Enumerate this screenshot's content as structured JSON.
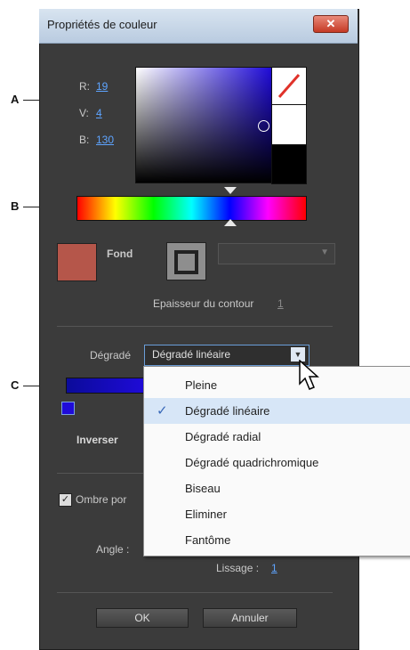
{
  "window": {
    "title": "Propriétés de couleur",
    "close_label": "✕"
  },
  "callouts": [
    "A",
    "B",
    "C"
  ],
  "color_picker": {
    "r_label": "R:",
    "r_value": "19",
    "v_label": "V:",
    "v_value": "4",
    "b_label": "B:",
    "b_value": "130",
    "base_color": "#1f0bd8",
    "selected_color": "#13047f"
  },
  "fill": {
    "label": "Fond",
    "color": "#b5564a"
  },
  "stroke": {
    "thickness_label": "Epaisseur du contour",
    "thickness_value": "1"
  },
  "gradient": {
    "label": "Dégradé",
    "selected": "Dégradé linéaire",
    "invert_label": "Inverser",
    "menu_items": [
      {
        "label": "Pleine",
        "checked": false
      },
      {
        "label": "Dégradé linéaire",
        "checked": true
      },
      {
        "label": "Dégradé radial",
        "checked": false
      },
      {
        "label": "Dégradé quadrichromique",
        "checked": false
      },
      {
        "label": "Biseau",
        "checked": false
      },
      {
        "label": "Eliminer",
        "checked": false
      },
      {
        "label": "Fantôme",
        "checked": false
      }
    ]
  },
  "shadow": {
    "label": "Ombre por",
    "checked": true,
    "angle_label": "Angle :",
    "smoothing_label": "Lissage :",
    "smoothing_value": "1"
  },
  "buttons": {
    "ok": "OK",
    "cancel": "Annuler"
  }
}
